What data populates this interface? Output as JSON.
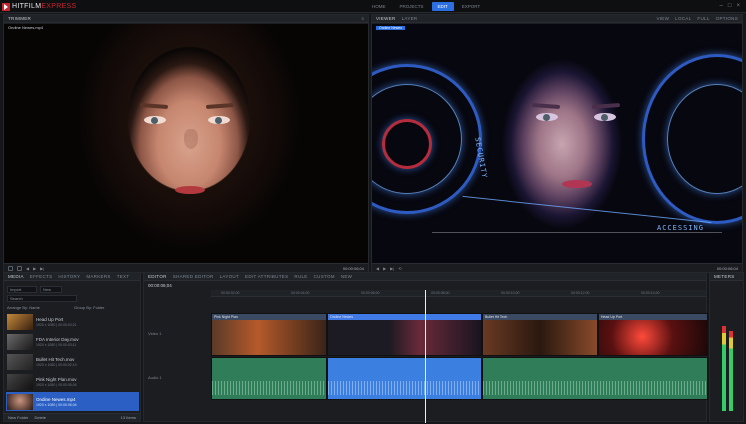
{
  "app": {
    "brand_main": "HITFILM",
    "brand_accent": "EXPRESS"
  },
  "workspace_tabs": [
    "HOME",
    "PROJECTS",
    "EDIT",
    "EXPORT"
  ],
  "workspace_active": "EDIT",
  "trimmer": {
    "title": "TRIMMER",
    "clip_name": "Ondine Newes.mp4",
    "timecode": "00:00:06;04"
  },
  "viewer": {
    "tabs": [
      "VIEWER",
      "LAYER"
    ],
    "tag": "Ondine Newes",
    "options": [
      "VIEW",
      "LOCAL",
      "FULL",
      "OPTIONS"
    ],
    "zoom": "FULL",
    "timecode": "00:00:06;04",
    "hud_text": [
      "SECURITY",
      "ACCESSING"
    ]
  },
  "media": {
    "tabs": [
      "MEDIA",
      "EFFECTS",
      "HISTORY",
      "MARKERS",
      "TEXT"
    ],
    "search_placeholder": "Search",
    "buttons": [
      "Import",
      "New"
    ],
    "arrange": "Arrange By: Name",
    "group": "Group By: Folder",
    "items": [
      {
        "name": "Head Up Port",
        "meta": "1920 x 1080 | 00:00:04;21"
      },
      {
        "name": "FDA Interior Day.mov",
        "meta": "1920 x 1080 | 00:00:03;11"
      },
      {
        "name": "Bullet Hit Tech.mov",
        "meta": "1920 x 1080 | 00:00:02;19"
      },
      {
        "name": "Pink Night Plan.mov",
        "meta": "1920 x 1080 | 00:00:05;04"
      },
      {
        "name": "Ondine Newes.mp4",
        "meta": "1920 x 1080 | 00:00:06;04"
      }
    ],
    "selected_index": 4,
    "footer_new_folder": "New Folder",
    "footer_delete": "Delete",
    "footer_count": "13 Items"
  },
  "editor": {
    "tabs": [
      "EDITOR",
      "SHARED EDITOR",
      "LAYOUT",
      "EDIT ATTRIBUTES",
      "RULE",
      "CUSTOM",
      "NEW"
    ],
    "timecode": "00:00:06;04",
    "track_video": "Video 1",
    "track_audio": "Audio 1",
    "ruler_ticks": [
      "00:00:02;00",
      "00:00:04;00",
      "00:00:06;00",
      "00:00:08;00",
      "00:00:10;00",
      "00:00:12;00",
      "00:00:14;00"
    ],
    "clips": [
      "Pink Night Plan",
      "Ondine Newes",
      "Bullet Hit Tech",
      "Head Up Port"
    ]
  },
  "meters": {
    "title": "METERS"
  },
  "colors": {
    "accent": "#2b6fe0",
    "brand_red": "#c6262e"
  }
}
